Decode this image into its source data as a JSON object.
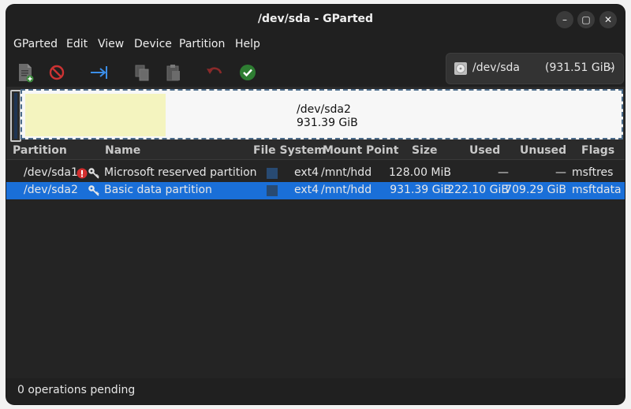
{
  "window": {
    "title": "/dev/sda - GParted",
    "controls": {
      "minimize": "–",
      "maximize": "▢",
      "close": "✕"
    }
  },
  "menubar": {
    "items": [
      "GParted",
      "Edit",
      "View",
      "Device",
      "Partition",
      "Help"
    ]
  },
  "toolbar": {
    "buttons": [
      {
        "icon": "new-partition-icon"
      },
      {
        "icon": "delete-icon"
      },
      {
        "icon": "resize-move-icon"
      },
      {
        "icon": "copy-icon"
      },
      {
        "icon": "paste-icon"
      },
      {
        "icon": "undo-icon"
      },
      {
        "icon": "apply-icon"
      }
    ]
  },
  "device_selector": {
    "device": "/dev/sda",
    "size": "(931.51 GiB)"
  },
  "partition_map": {
    "selected_label": "/dev/sda2",
    "selected_size": "931.39 GiB"
  },
  "table": {
    "columns": [
      "Partition",
      "Name",
      "File System",
      "Mount Point",
      "Size",
      "Used",
      "Unused",
      "Flags"
    ],
    "rows": [
      {
        "partition": "/dev/sda1",
        "warning": true,
        "key_icon": true,
        "name": "Microsoft reserved partition",
        "fs_color": "#284a72",
        "file_system": "ext4",
        "mount_point": "/mnt/hdd",
        "size": "128.00 MiB",
        "used": "—",
        "unused": "—",
        "flags": "msftres",
        "selected": false
      },
      {
        "partition": "/dev/sda2",
        "warning": false,
        "key_icon": true,
        "name": "Basic data partition",
        "fs_color": "#284a72",
        "file_system": "ext4",
        "mount_point": "/mnt/hdd",
        "size": "931.39 GiB",
        "used": "222.10 GiB",
        "unused": "709.29 GiB",
        "flags": "msftdata",
        "selected": true
      }
    ]
  },
  "status": {
    "text": "0 operations pending"
  },
  "colors": {
    "selection": "#1a6fd8",
    "used_space": "#f4f4bf",
    "ext4": "#284a72"
  }
}
